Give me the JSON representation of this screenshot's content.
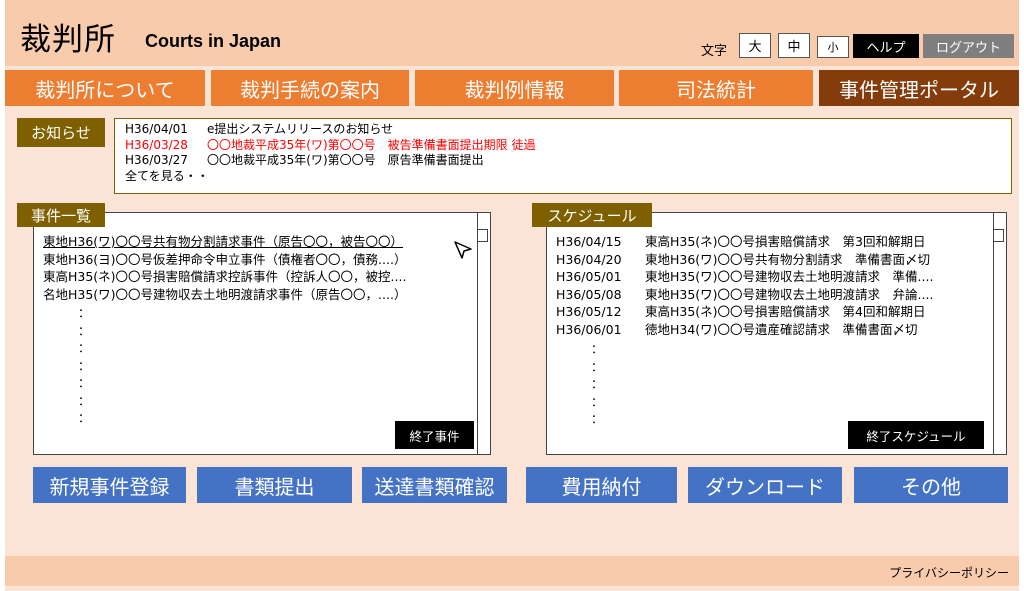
{
  "header": {
    "title": "裁判所",
    "subtitle": "Courts in Japan",
    "font_size_label": "文字",
    "font_sizes": {
      "large": "大",
      "medium": "中",
      "small": "小"
    },
    "help": "ヘルプ",
    "logout": "ログアウト"
  },
  "nav": {
    "items": [
      {
        "label": "裁判所について"
      },
      {
        "label": "裁判手続の案内"
      },
      {
        "label": "裁判例情報"
      },
      {
        "label": "司法統計"
      },
      {
        "label": "事件管理ポータル",
        "active": true
      }
    ]
  },
  "notice": {
    "label": "お知らせ",
    "items": [
      {
        "date": "H36/04/01",
        "text": "e提出システムリリースのお知らせ",
        "color": "#000000"
      },
      {
        "date": "H36/03/28",
        "text": "〇〇地裁平成35年(ワ)第〇〇号　被告準備書面提出期限 徒過",
        "color": "#ff0000"
      },
      {
        "date": "H36/03/27",
        "text": "〇〇地裁平成35年(ワ)第〇〇号　原告準備書面提出",
        "color": "#000000"
      }
    ],
    "see_all": "全てを見る・・"
  },
  "cases": {
    "label": "事件一覧",
    "items": [
      "東地H36(ワ)〇〇号共有物分割請求事件（原告〇〇，被告〇〇）",
      "東地H36(ヨ)〇〇号仮差押命令申立事件（債権者〇〇，債務....）",
      "東高H35(ネ)〇〇号損害賠償請求控訴事件（控訴人〇〇，被控....",
      "名地H35(ワ)〇〇号建物収去土地明渡請求事件（原告〇〇，....）"
    ],
    "ellipsis": "：",
    "closed_button": "終了事件"
  },
  "schedule": {
    "label": "スケジュール",
    "items": [
      {
        "date": "H36/04/15",
        "text": "東高H35(ネ)〇〇号損害賠償請求　第3回和解期日"
      },
      {
        "date": "H36/04/20",
        "text": "東地H36(ワ)〇〇号共有物分割請求　準備書面〆切"
      },
      {
        "date": "H36/05/01",
        "text": "東地H35(ワ)〇〇号建物収去土地明渡請求　準備...."
      },
      {
        "date": "H36/05/08",
        "text": "東地H35(ワ)〇〇号建物収去土地明渡請求　弁論...."
      },
      {
        "date": "H36/05/12",
        "text": "東高H35(ネ)〇〇号損害賠償請求　第4回和解期日"
      },
      {
        "date": "H36/06/01",
        "text": "徳地H34(ワ)〇〇号遺産確認請求　準備書面〆切"
      }
    ],
    "ellipsis": "：",
    "closed_button": "終了スケジュール"
  },
  "actions": {
    "new_case": "新規事件登録",
    "submit_docs": "書類提出",
    "delivery_check": "送達書類確認",
    "fee_payment": "費用納付",
    "download": "ダウンロード",
    "other": "その他"
  },
  "footer": {
    "privacy": "プライバシーポリシー"
  },
  "colors": {
    "header_bg": "#f8cbad",
    "page_bg": "#fbe4d5",
    "nav_orange": "#ed7d31",
    "nav_active": "#843c0c",
    "label_olive": "#7f6000",
    "action_blue": "#4472c4",
    "alert_red": "#ff0000"
  }
}
